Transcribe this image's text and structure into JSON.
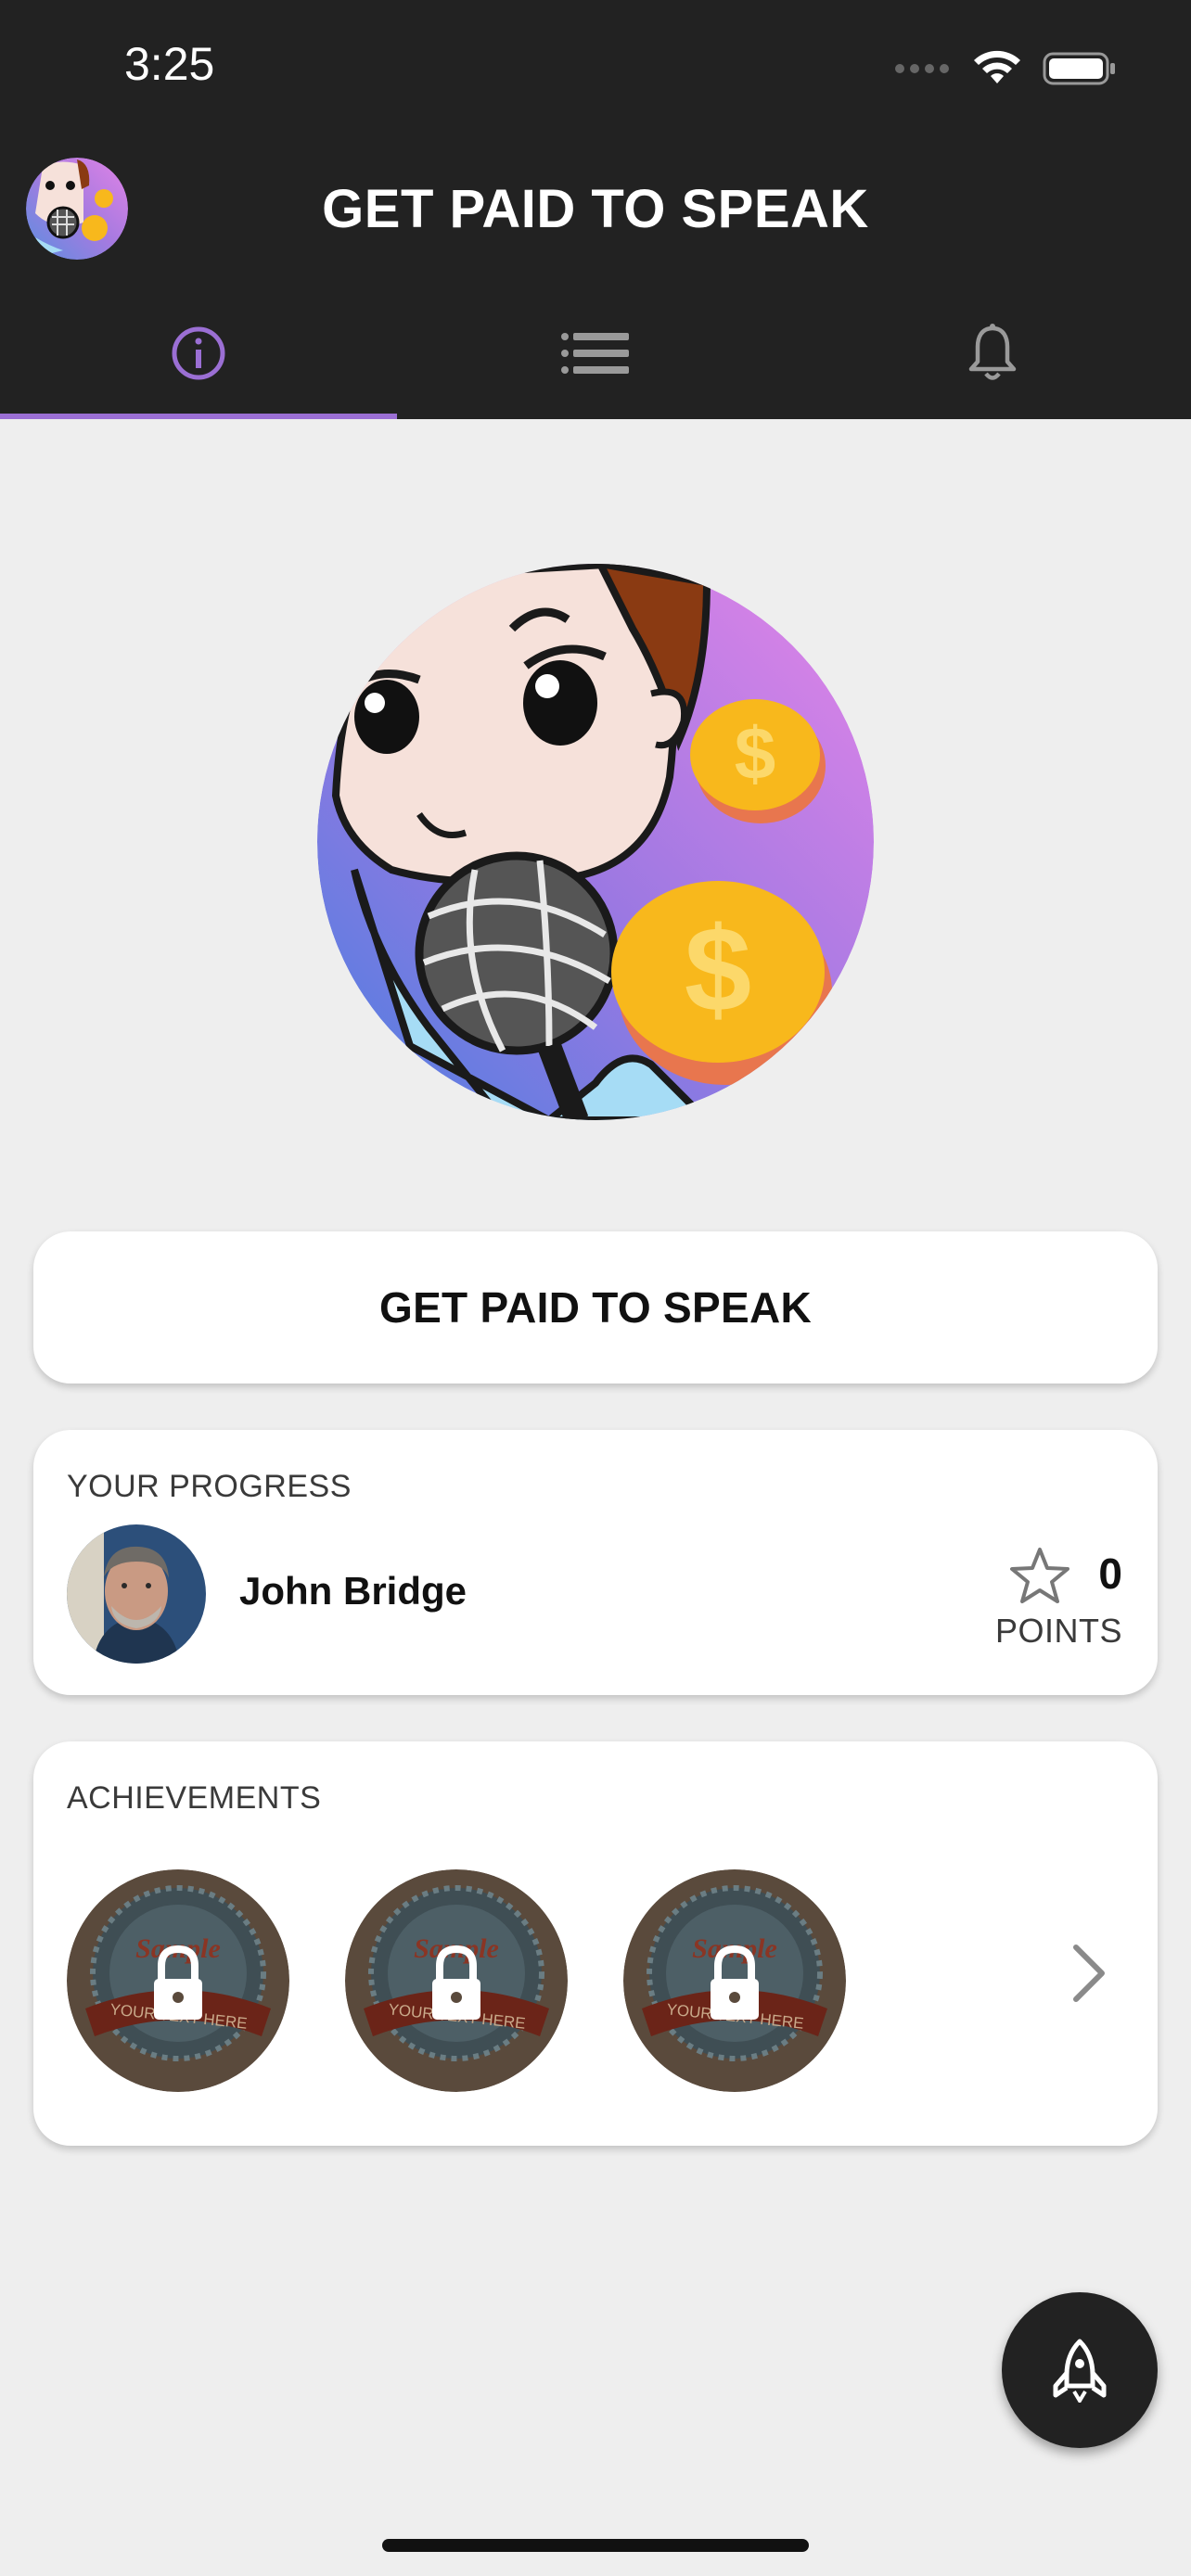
{
  "status_bar": {
    "time": "3:25"
  },
  "header": {
    "title": "GET PAID TO SPEAK",
    "logo_icon": "app-logo-mic-girl"
  },
  "tabs": [
    {
      "name": "info",
      "icon": "info-icon",
      "active": true
    },
    {
      "name": "list",
      "icon": "list-icon",
      "active": false
    },
    {
      "name": "notifications",
      "icon": "bell-icon",
      "active": false
    }
  ],
  "colors": {
    "topbar": "#222222",
    "accent": "#9b6fd4",
    "background": "#eeeeee",
    "coin": "#f8b81c"
  },
  "hero": {
    "icon": "mic-girl-coins-illustration"
  },
  "cta": {
    "label": "GET PAID TO SPEAK"
  },
  "progress": {
    "section_label": "YOUR PROGRESS",
    "user_name": "John Bridge",
    "points_value": "0",
    "points_label": "POINTS"
  },
  "achievements": {
    "section_label": "ACHIEVEMENTS",
    "badges": [
      {
        "icon": "locked-badge-icon",
        "text_top": "Sample",
        "text_ribbon": "YOUR TEXT HERE"
      },
      {
        "icon": "locked-badge-icon",
        "text_top": "Sample",
        "text_ribbon": "YOUR TEXT HERE"
      },
      {
        "icon": "locked-badge-icon",
        "text_top": "Sample",
        "text_ribbon": "YOUR TEXT HERE"
      }
    ]
  },
  "fab": {
    "icon": "rocket-icon"
  }
}
